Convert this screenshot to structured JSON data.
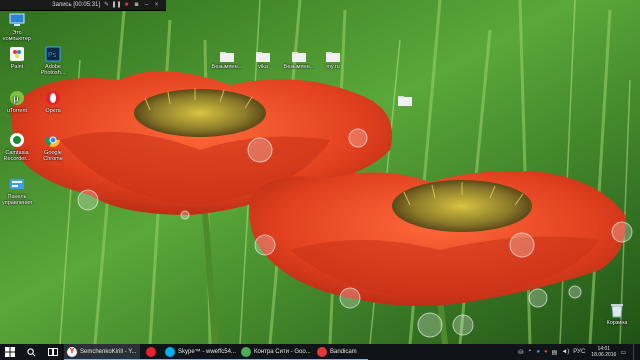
{
  "recorder": {
    "title": "Запись [00:05:31]"
  },
  "desktop": {
    "icons_left": [
      {
        "label": "Это компьютер",
        "icon": "computer-icon"
      },
      {
        "label": "Paint",
        "icon": "paint-icon"
      },
      {
        "label": "Adobe Photosh...",
        "icon": "photoshop-icon"
      },
      {
        "label": "uTorrent",
        "icon": "utorrent-icon"
      },
      {
        "label": "Opera",
        "icon": "opera-icon"
      },
      {
        "label": "Camtasia Recorder...",
        "icon": "camtasia-icon"
      },
      {
        "label": "Google Chrome",
        "icon": "chrome-icon"
      },
      {
        "label": "Панель управления",
        "icon": "control-panel-icon"
      }
    ],
    "folders_top": [
      {
        "label": "Безымянн..."
      },
      {
        "label": "vika"
      },
      {
        "label": "Безымянн..."
      },
      {
        "label": "my.ru"
      }
    ],
    "recycle_bin": {
      "label": "Корзина",
      "icon": "recycle-bin-icon"
    }
  },
  "taskbar": {
    "tasks": [
      {
        "label": "SemchenkoKirill - Y...",
        "icon": "yandex-browser-icon",
        "color": "#ffffff"
      },
      {
        "label": "",
        "icon": "opera-icon",
        "color": "#e3222c"
      },
      {
        "label": "Skype™ - wweffc54...",
        "icon": "skype-icon",
        "color": "#00aff0"
      },
      {
        "label": "Контра Сити - Goo...",
        "icon": "chrome-icon",
        "color": "#4caf50"
      },
      {
        "label": "Bandicam",
        "icon": "bandicam-icon",
        "color": "#e53935"
      }
    ],
    "language": "РУС",
    "time": "14:01",
    "date": "18.06.2016"
  },
  "colors": {
    "taskbar_bg": "#101317",
    "accent": "#7fb3ff",
    "wallpaper_green": "#3f8f2a",
    "poppy_red": "#e2401f"
  }
}
